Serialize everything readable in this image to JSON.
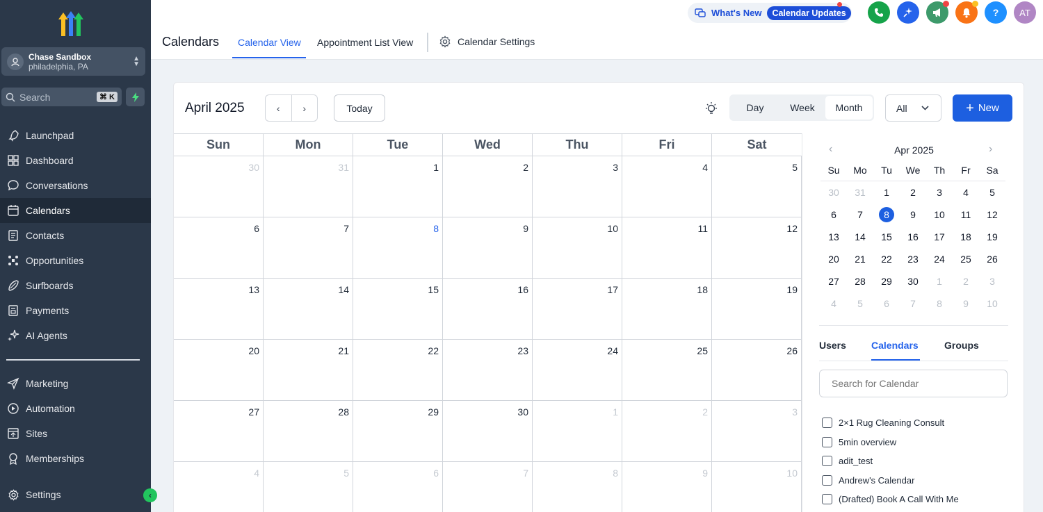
{
  "sidebar": {
    "account": {
      "name": "Chase Sandbox",
      "location": "philadelphia, PA"
    },
    "search": {
      "placeholder": "Search",
      "shortcut": "⌘ K"
    },
    "items_top": [
      {
        "label": "Launchpad",
        "icon": "rocket-icon"
      },
      {
        "label": "Dashboard",
        "icon": "grid-icon"
      },
      {
        "label": "Conversations",
        "icon": "chat-icon"
      },
      {
        "label": "Calendars",
        "icon": "calendar-icon",
        "active": true
      },
      {
        "label": "Contacts",
        "icon": "contacts-icon"
      },
      {
        "label": "Opportunities",
        "icon": "opportunities-icon"
      },
      {
        "label": "Surfboards",
        "icon": "surfboard-icon"
      },
      {
        "label": "Payments",
        "icon": "payments-icon"
      },
      {
        "label": "AI Agents",
        "icon": "sparkle-icon"
      }
    ],
    "items_bottom": [
      {
        "label": "Marketing",
        "icon": "send-icon"
      },
      {
        "label": "Automation",
        "icon": "automation-icon"
      },
      {
        "label": "Sites",
        "icon": "sites-icon"
      },
      {
        "label": "Memberships",
        "icon": "award-icon"
      }
    ],
    "settings": {
      "label": "Settings",
      "icon": "gear-icon"
    }
  },
  "header": {
    "whats_new": "What's New",
    "calendar_updates": "Calendar Updates",
    "page_title": "Calendars",
    "tabs": [
      "Calendar View",
      "Appointment List View",
      "Calendar Settings"
    ],
    "avatar_initials": "AT",
    "help_label": "?",
    "colors": {
      "phone": "#16a34a",
      "magic": "#2563eb",
      "announce": "#3d9a6b",
      "bell": "#f97316",
      "help": "#1e90ff",
      "avatar": "#b086c4"
    }
  },
  "toolbar": {
    "month_title": "April 2025",
    "today": "Today",
    "views": [
      "Day",
      "Week",
      "Month"
    ],
    "active_view": "Month",
    "filter": "All",
    "new_button": "New"
  },
  "month_grid": {
    "weekdays": [
      "Sun",
      "Mon",
      "Tue",
      "Wed",
      "Thu",
      "Fri",
      "Sat"
    ],
    "weeks": [
      [
        {
          "d": "30",
          "o": true
        },
        {
          "d": "31",
          "o": true
        },
        {
          "d": "1"
        },
        {
          "d": "2"
        },
        {
          "d": "3"
        },
        {
          "d": "4"
        },
        {
          "d": "5"
        }
      ],
      [
        {
          "d": "6"
        },
        {
          "d": "7"
        },
        {
          "d": "8",
          "t": true
        },
        {
          "d": "9"
        },
        {
          "d": "10"
        },
        {
          "d": "11"
        },
        {
          "d": "12"
        }
      ],
      [
        {
          "d": "13"
        },
        {
          "d": "14"
        },
        {
          "d": "15"
        },
        {
          "d": "16"
        },
        {
          "d": "17"
        },
        {
          "d": "18"
        },
        {
          "d": "19"
        }
      ],
      [
        {
          "d": "20"
        },
        {
          "d": "21"
        },
        {
          "d": "22"
        },
        {
          "d": "23"
        },
        {
          "d": "24"
        },
        {
          "d": "25"
        },
        {
          "d": "26"
        }
      ],
      [
        {
          "d": "27"
        },
        {
          "d": "28"
        },
        {
          "d": "29"
        },
        {
          "d": "30"
        },
        {
          "d": "1",
          "o": true
        },
        {
          "d": "2",
          "o": true
        },
        {
          "d": "3",
          "o": true
        }
      ],
      [
        {
          "d": "4",
          "o": true
        },
        {
          "d": "5",
          "o": true
        },
        {
          "d": "6",
          "o": true
        },
        {
          "d": "7",
          "o": true
        },
        {
          "d": "8",
          "o": true
        },
        {
          "d": "9",
          "o": true
        },
        {
          "d": "10",
          "o": true
        }
      ]
    ]
  },
  "mini_calendar": {
    "title": "Apr 2025",
    "weekdays": [
      "Su",
      "Mo",
      "Tu",
      "We",
      "Th",
      "Fr",
      "Sa"
    ],
    "weeks": [
      [
        {
          "d": "30",
          "o": true
        },
        {
          "d": "31",
          "o": true
        },
        {
          "d": "1"
        },
        {
          "d": "2"
        },
        {
          "d": "3"
        },
        {
          "d": "4"
        },
        {
          "d": "5"
        }
      ],
      [
        {
          "d": "6"
        },
        {
          "d": "7"
        },
        {
          "d": "8",
          "s": true
        },
        {
          "d": "9"
        },
        {
          "d": "10"
        },
        {
          "d": "11"
        },
        {
          "d": "12"
        }
      ],
      [
        {
          "d": "13"
        },
        {
          "d": "14"
        },
        {
          "d": "15"
        },
        {
          "d": "16"
        },
        {
          "d": "17"
        },
        {
          "d": "18"
        },
        {
          "d": "19"
        }
      ],
      [
        {
          "d": "20"
        },
        {
          "d": "21"
        },
        {
          "d": "22"
        },
        {
          "d": "23"
        },
        {
          "d": "24"
        },
        {
          "d": "25"
        },
        {
          "d": "26"
        }
      ],
      [
        {
          "d": "27"
        },
        {
          "d": "28"
        },
        {
          "d": "29"
        },
        {
          "d": "30"
        },
        {
          "d": "1",
          "o": true
        },
        {
          "d": "2",
          "o": true
        },
        {
          "d": "3",
          "o": true
        }
      ],
      [
        {
          "d": "4",
          "o": true
        },
        {
          "d": "5",
          "o": true
        },
        {
          "d": "6",
          "o": true
        },
        {
          "d": "7",
          "o": true
        },
        {
          "d": "8",
          "o": true
        },
        {
          "d": "9",
          "o": true
        },
        {
          "d": "10",
          "o": true
        }
      ]
    ]
  },
  "panel": {
    "tabs": [
      "Users",
      "Calendars",
      "Groups"
    ],
    "active_tab": "Calendars",
    "search_placeholder": "Search for Calendar",
    "calendars": [
      "2×1 Rug Cleaning Consult",
      "5min overview",
      "adit_test",
      "Andrew's Calendar",
      "(Drafted) Book A Call With Me"
    ]
  }
}
